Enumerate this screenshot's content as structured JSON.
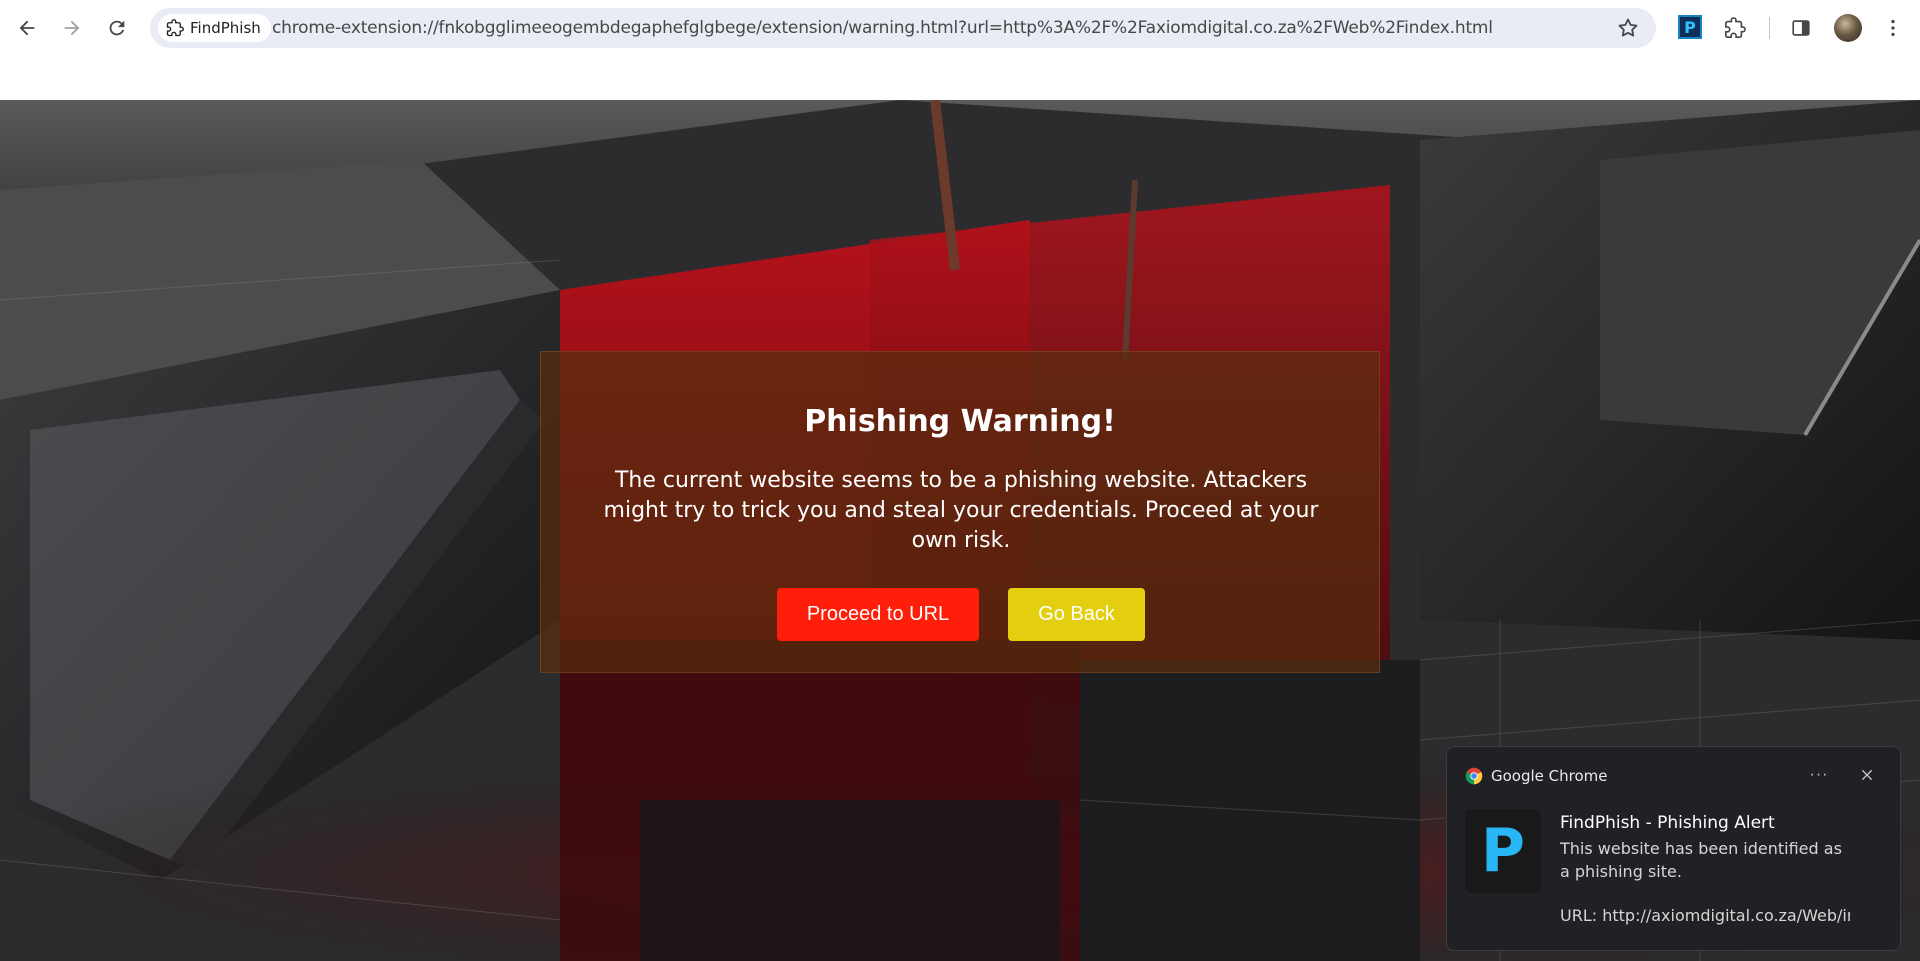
{
  "browser": {
    "site_chip_label": "FindPhish",
    "url": "chrome-extension://fnkobgglimeeogembdegaphefglgbege/extension/warning.html?url=http%3A%2F%2Faxiomdigital.co.za%2FWeb%2Findex.html",
    "extension_badge": "P",
    "icons": [
      "back-icon",
      "forward-icon",
      "reload-icon",
      "extension-icon",
      "star-icon",
      "puzzle-icon",
      "side-panel-icon",
      "avatar",
      "kebab-menu-icon"
    ]
  },
  "warning": {
    "title": "Phishing Warning!",
    "message": "The current website seems to be a phishing website. Attackers might try to trick you and steal your credentials. Proceed at your own risk.",
    "proceed_label": "Proceed to URL",
    "back_label": "Go Back",
    "colors": {
      "proceed": "#ff1e0a",
      "back": "#e3cf10"
    }
  },
  "notification": {
    "app_name": "Google Chrome",
    "more_label": "···",
    "icon_letter": "P",
    "title": "FindPhish - Phishing Alert",
    "body": "This website has been identified as a phishing site.",
    "url_line": "URL: http://axiomdigital.co.za/Web/index.html"
  }
}
